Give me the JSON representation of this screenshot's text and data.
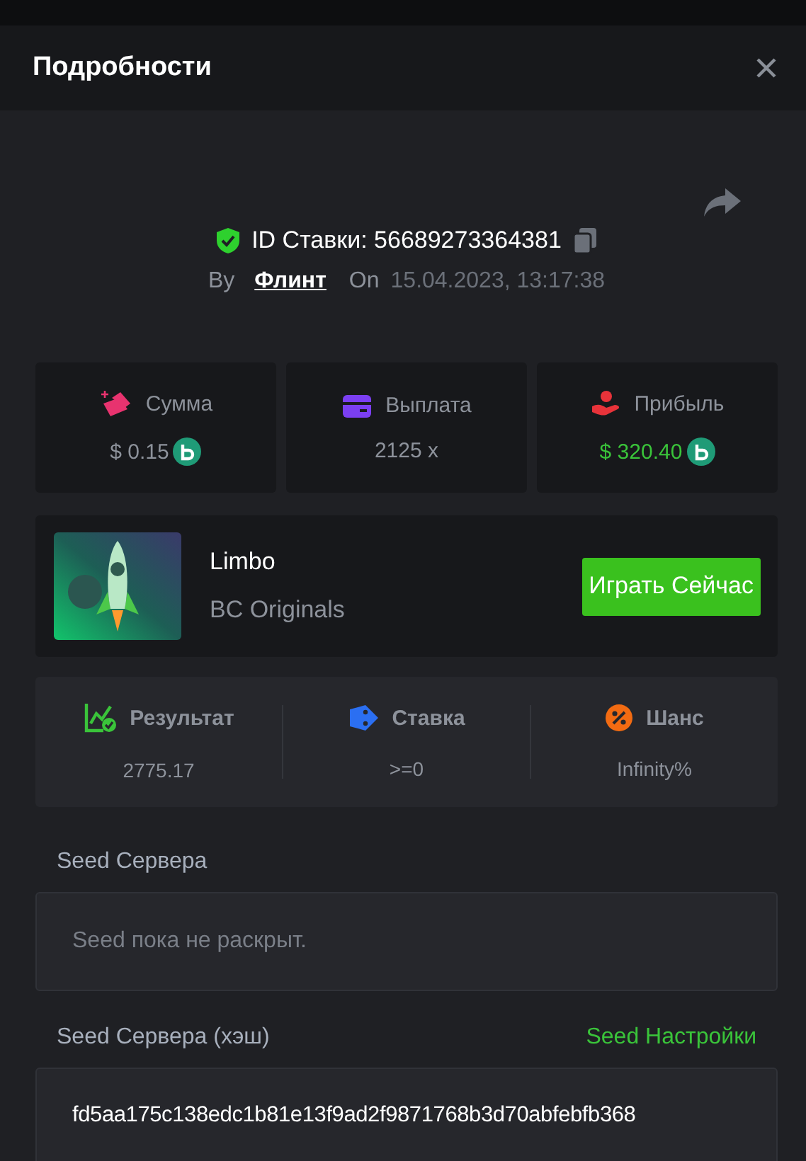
{
  "header": {
    "title": "Подробности"
  },
  "bet": {
    "id_label": "ID Ставки: 56689273364381",
    "by_label": "By",
    "user": "Флинт",
    "on_label": "On",
    "date": "15.04.2023, 13:17:38"
  },
  "stats": [
    {
      "kind": "amount",
      "label": "Сумма",
      "value": "$ 0.15",
      "coin": true
    },
    {
      "kind": "payout",
      "label": "Выплата",
      "value": "2125 x",
      "coin": false
    },
    {
      "kind": "profit",
      "label": "Прибыль",
      "value": "$ 320.40",
      "coin": true
    }
  ],
  "game": {
    "name": "Limbo",
    "provider": "BC Originals",
    "play_button": "Играть Сейчас"
  },
  "results": [
    {
      "kind": "result",
      "label": "Результат",
      "value": "2775.17"
    },
    {
      "kind": "bet",
      "label": "Ставка",
      "value": ">=0"
    },
    {
      "kind": "chance",
      "label": "Шанс",
      "value": "Infinity%"
    }
  ],
  "seed": {
    "label": "Seed Сервера",
    "value": "Seed пока не раскрыт."
  },
  "hash": {
    "label": "Seed Сервера (хэш)",
    "link": "Seed Настройки",
    "value": "fd5aa175c138edc1b81e13f9ad2f9871768b3d70abfebfb368"
  }
}
